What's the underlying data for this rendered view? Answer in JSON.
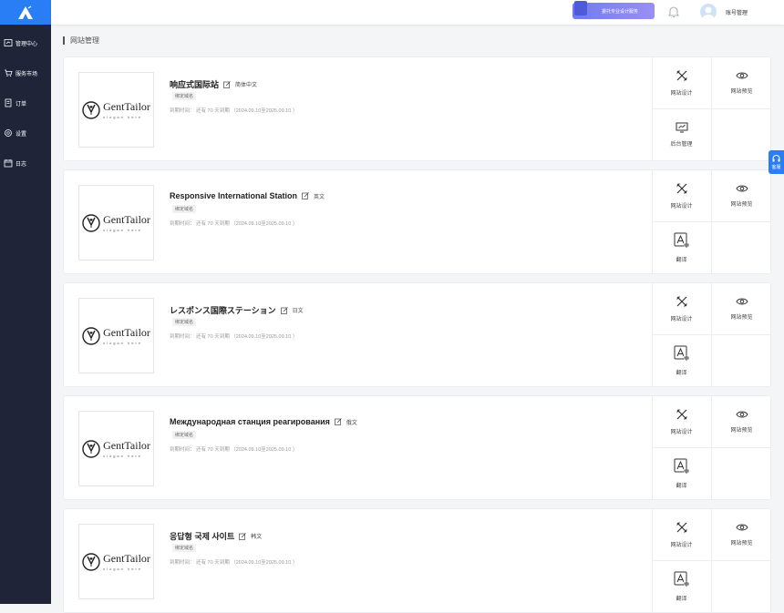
{
  "sidebar": {
    "items": [
      {
        "label": "管理中心",
        "icon": "dashboard-icon"
      },
      {
        "label": "服务市场",
        "icon": "cart-icon"
      },
      {
        "label": "订单",
        "icon": "order-icon"
      },
      {
        "label": "设置",
        "icon": "gear-icon"
      },
      {
        "label": "日志",
        "icon": "calendar-icon"
      }
    ]
  },
  "topbar": {
    "promo_label": "委托专业设计服务",
    "account_label": "账号管理"
  },
  "page": {
    "title": "网站管理"
  },
  "logo": {
    "name": "GentTailor",
    "slogan": "slogan here"
  },
  "cards": [
    {
      "title": "响应式国际站",
      "lang": "简体中文",
      "tag": "绑定域名",
      "expire": "到期时间： 还有 70 天到期 （2024.09.10至2025.09.10 ）",
      "actions": [
        "网站设计",
        "网站预览",
        "后台管理"
      ]
    },
    {
      "title": "Responsive International Station",
      "lang": "英文",
      "tag": "绑定域名",
      "expire": "到期时间： 还有 70 天到期 （2024.09.10至2025.09.10 ）",
      "actions": [
        "网站设计",
        "网站预览",
        "翻译"
      ]
    },
    {
      "title": "レスポンス国際ステーション",
      "lang": "日文",
      "tag": "绑定域名",
      "expire": "到期时间： 还有 70 天到期 （2024.09.10至2025.09.10 ）",
      "actions": [
        "网站设计",
        "网站预览",
        "翻译"
      ]
    },
    {
      "title": "Международная станция реагирования",
      "lang": "俄文",
      "tag": "绑定域名",
      "expire": "到期时间： 还有 70 天到期 （2024.09.10至2025.09.10 ）",
      "actions": [
        "网站设计",
        "网站预览",
        "翻译"
      ]
    },
    {
      "title": "응답형 국제 사이트",
      "lang": "韩文",
      "tag": "绑定域名",
      "expire": "到期时间： 还有 70 天到期 （2024.09.10至2025.09.10 ）",
      "actions": [
        "网站设计",
        "网站预览",
        "翻译"
      ]
    }
  ],
  "float_service": {
    "label": "客服"
  },
  "colors": {
    "sidebar": "#1f2438",
    "accent": "#2a7ef5"
  }
}
